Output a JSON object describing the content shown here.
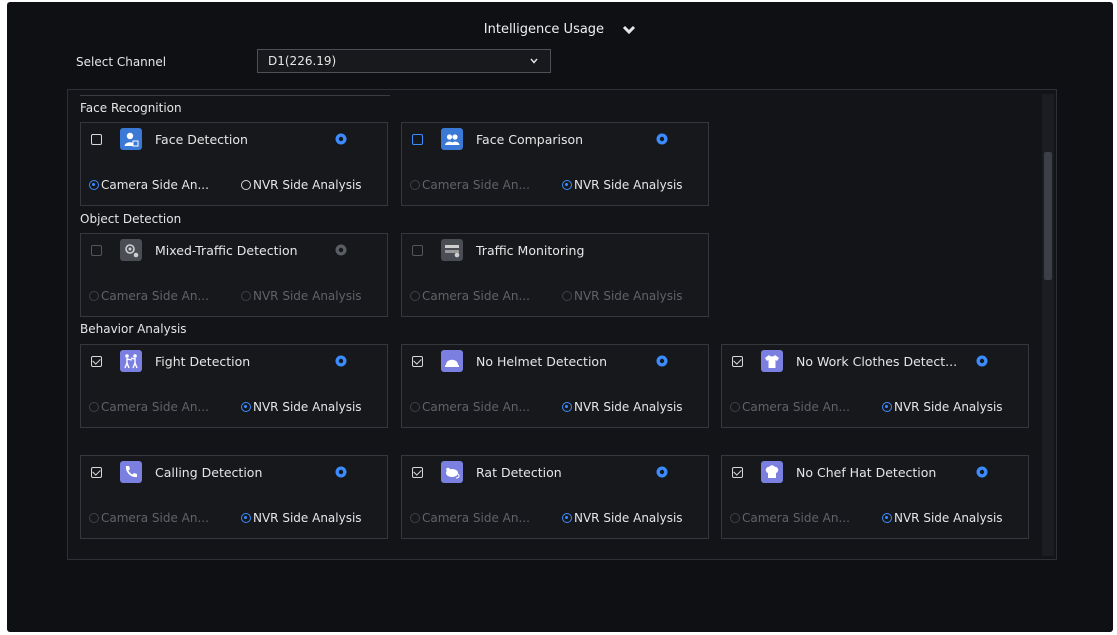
{
  "header": {
    "title": "Intelligence Usage"
  },
  "channel": {
    "label": "Select Channel",
    "value": "D1(226.19)"
  },
  "sections": {
    "face": "Face Recognition",
    "object": "Object Detection",
    "behavior": "Behavior Analysis"
  },
  "options": {
    "camera": "Camera Side An...",
    "nvr": "NVR Side Analysis"
  },
  "cards": {
    "face_detection": {
      "name": "Face Detection",
      "checked": false,
      "icon": "person-icon",
      "selected": "camera"
    },
    "face_comparison": {
      "name": "Face Comparison",
      "checked": false,
      "icon": "people-icon",
      "selected": "nvr"
    },
    "mixed_traffic": {
      "name": "Mixed-Traffic Detection",
      "checked": false,
      "disabled": true,
      "icon": "traffic-camera-icon",
      "selected": "camera"
    },
    "traffic_monitoring": {
      "name": "Traffic Monitoring",
      "checked": false,
      "disabled": true,
      "icon": "road-icon",
      "selected": "camera"
    },
    "fight": {
      "name": "Fight Detection",
      "checked": true,
      "icon": "fight-icon",
      "selected": "nvr"
    },
    "no_helmet": {
      "name": "No Helmet Detection",
      "checked": true,
      "icon": "helmet-icon",
      "selected": "nvr"
    },
    "no_work_clothes": {
      "name": "No Work Clothes Detect...",
      "checked": true,
      "icon": "shirt-icon",
      "selected": "nvr"
    },
    "calling": {
      "name": "Calling Detection",
      "checked": true,
      "icon": "phone-icon",
      "selected": "nvr"
    },
    "rat": {
      "name": "Rat Detection",
      "checked": true,
      "icon": "rat-icon",
      "selected": "nvr"
    },
    "no_chef_hat": {
      "name": "No Chef Hat Detection",
      "checked": true,
      "icon": "chef-hat-icon",
      "selected": "nvr"
    }
  },
  "colors": {
    "accent": "#3b8cff",
    "background": "#0e1014",
    "icon_purple": "#7a7fe0"
  }
}
